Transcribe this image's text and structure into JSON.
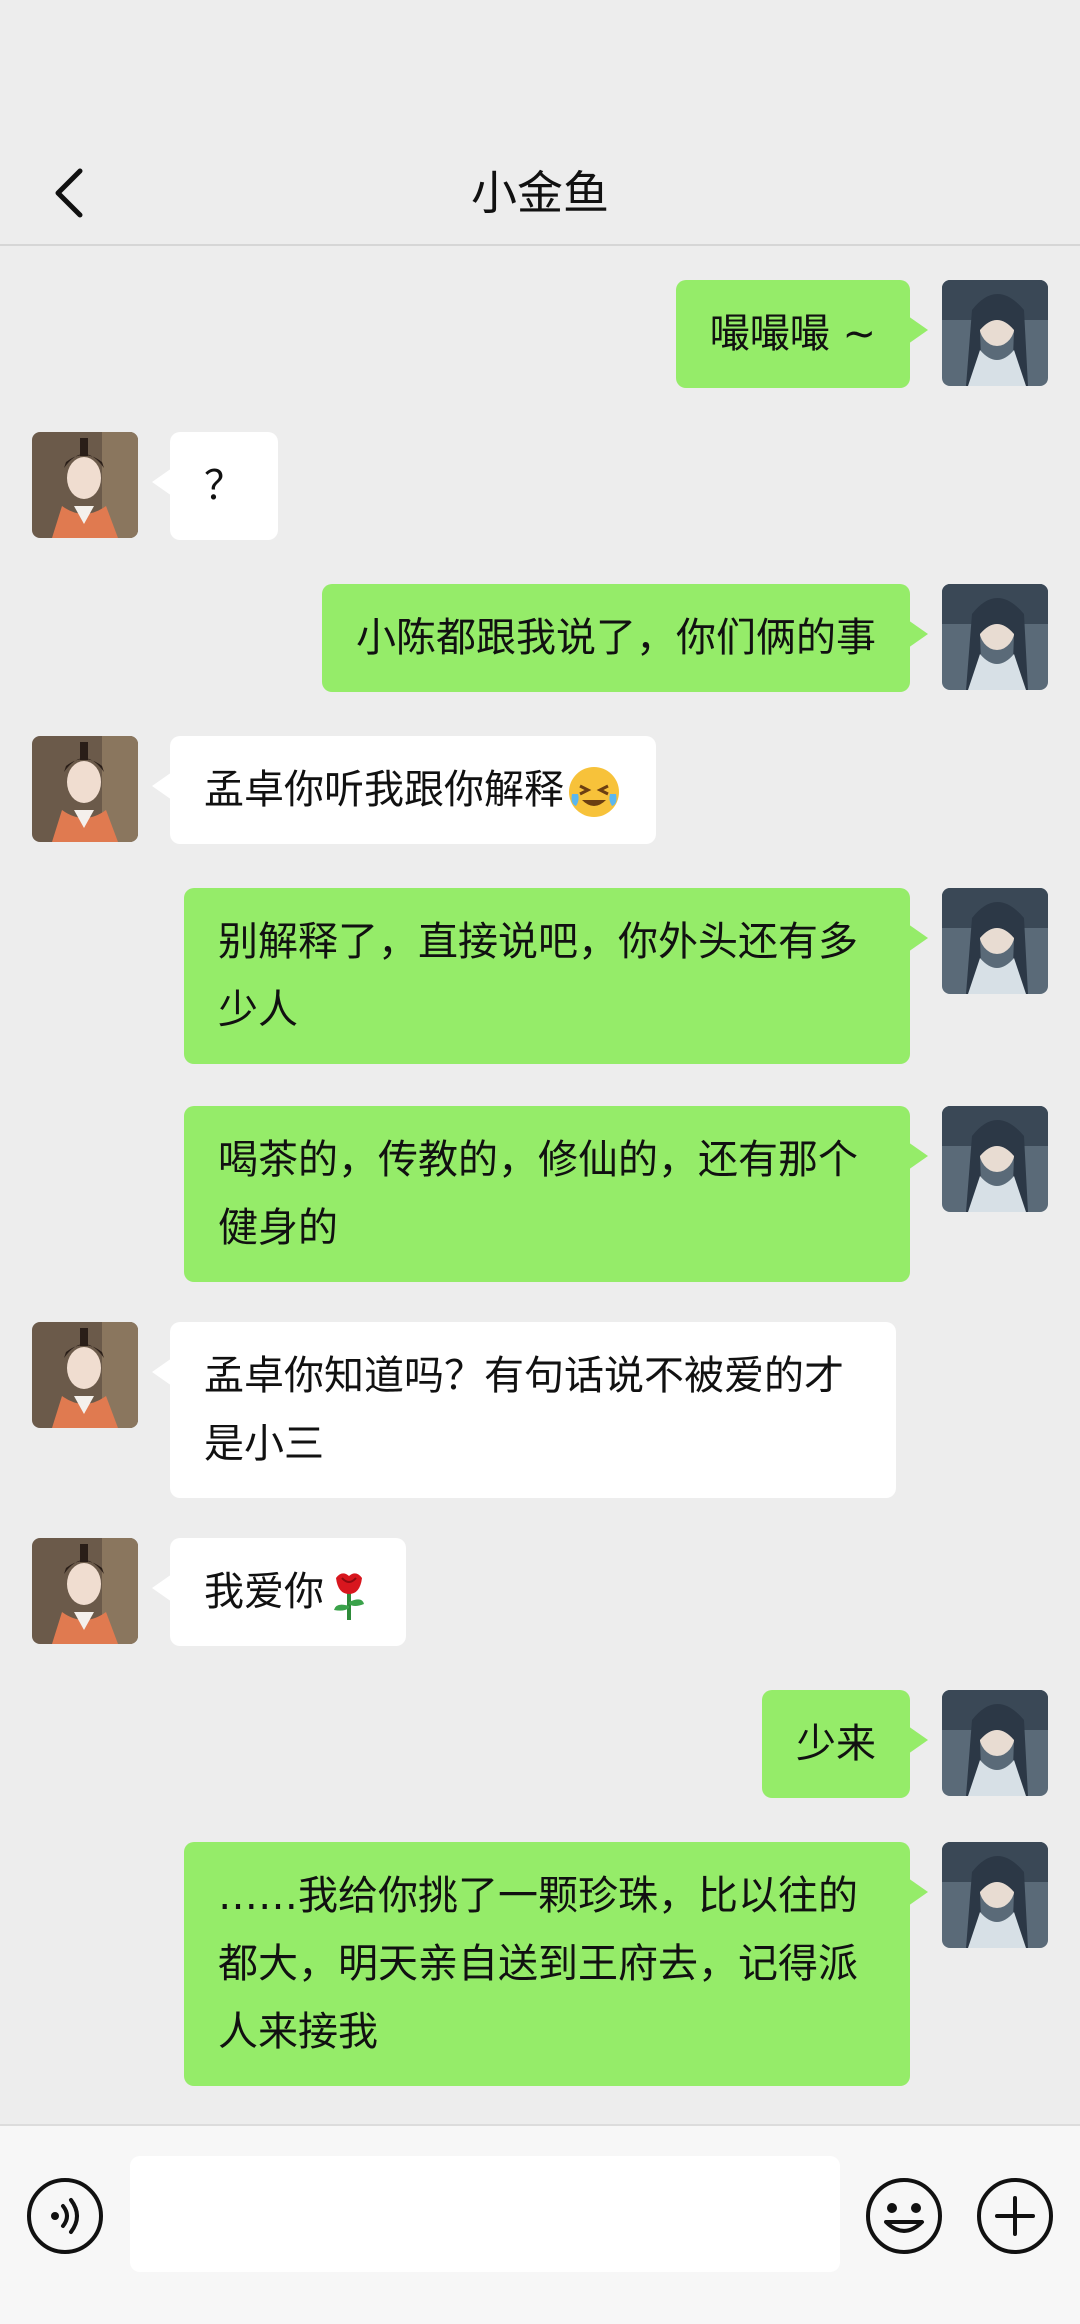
{
  "header": {
    "title": "小金鱼"
  },
  "messages": [
    {
      "side": "me",
      "text": "嘬嘬嘬 ~"
    },
    {
      "side": "them",
      "text": "？"
    },
    {
      "side": "me",
      "text": "小陈都跟我说了，你们俩的事"
    },
    {
      "side": "them",
      "text": "孟卓你听我跟你解释",
      "emoji": "crying-laugh-emoji"
    },
    {
      "side": "me",
      "text": "别解释了，直接说吧，你外头还有多少人"
    },
    {
      "side": "me",
      "text": "喝茶的，传教的，修仙的，还有那个健身的"
    },
    {
      "side": "them",
      "text": "孟卓你知道吗？有句话说不被爱的才是小三"
    },
    {
      "side": "them",
      "text": "我爱你",
      "emoji": "rose-emoji"
    },
    {
      "side": "me",
      "text": "少来"
    },
    {
      "side": "me",
      "text": "……我给你挑了一颗珍珠，比以往的都大，明天亲自送到王府去，记得派人来接我"
    }
  ],
  "input": {
    "placeholder": ""
  },
  "colors": {
    "background": "#ededed",
    "my_bubble": "#95ec69",
    "their_bubble": "#ffffff"
  },
  "icons": [
    "back-arrow-icon",
    "voice-icon",
    "emoji-face-icon",
    "plus-icon"
  ]
}
